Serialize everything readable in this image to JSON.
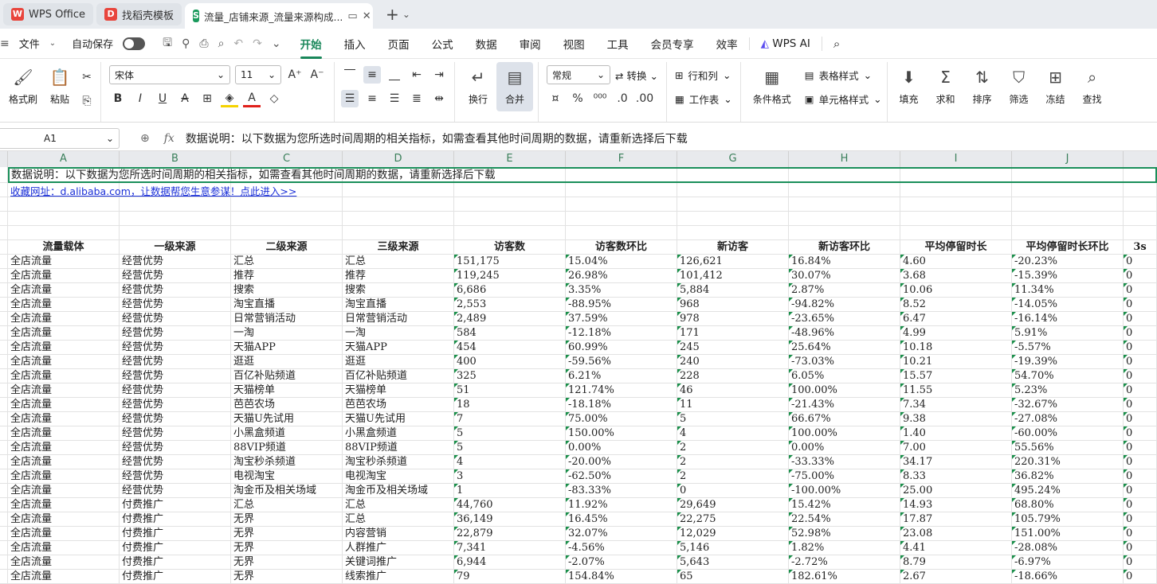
{
  "tabs": [
    {
      "label": "WPS Office",
      "icon": "wps-logo-icon"
    },
    {
      "label": "找稻壳模板",
      "icon": "docer-icon"
    },
    {
      "label": "流量_店铺来源_流量来源构成...",
      "icon": "spreadsheet-icon",
      "active": true
    }
  ],
  "menu": {
    "file": "文件",
    "autosave": "自动保存",
    "items": [
      "开始",
      "插入",
      "页面",
      "公式",
      "数据",
      "审阅",
      "视图",
      "工具",
      "会员专享",
      "效率"
    ],
    "ai": "WPS AI"
  },
  "ribbon": {
    "format_painter": "格式刷",
    "paste": "粘贴",
    "font_name": "宋体",
    "font_size": "11",
    "wrap": "换行",
    "merge": "合并",
    "number_format": "常规",
    "convert": "转换",
    "rowcol": "行和列",
    "worksheet": "工作表",
    "cond_format": "条件格式",
    "table_style": "表格样式",
    "cell_style": "单元格样式",
    "fill": "填充",
    "sum": "求和",
    "sort": "排序",
    "filter": "筛选",
    "freeze": "冻结",
    "find": "查找"
  },
  "formula_bar": {
    "cell_ref": "A1",
    "fx": "fx",
    "content": "数据说明：以下数据为您所选时间周期的相关指标，如需查看其他时间周期的数据，请重新选择后下载"
  },
  "columns": [
    "A",
    "B",
    "C",
    "D",
    "E",
    "F",
    "G",
    "H",
    "I",
    "J"
  ],
  "sheet": {
    "note": "数据说明：以下数据为您所选时间周期的相关指标，如需查看其他时间周期的数据，请重新选择后下载",
    "link": "收藏网址：d.alibaba.com，让数据帮您生意参谋！点此进入>>",
    "headers": [
      "流量载体",
      "一级来源",
      "二级来源",
      "三级来源",
      "访客数",
      "访客数环比",
      "新访客",
      "新访客环比",
      "平均停留时长",
      "平均停留时长环比",
      "3s"
    ],
    "rows": [
      [
        "全店流量",
        "经营优势",
        "汇总",
        "汇总",
        "151,175",
        "15.04%",
        "126,621",
        "16.84%",
        "4.60",
        "-20.23%",
        "0"
      ],
      [
        "全店流量",
        "经营优势",
        "推荐",
        "推荐",
        "119,245",
        "26.98%",
        "101,412",
        "30.07%",
        "3.68",
        "-15.39%",
        "0"
      ],
      [
        "全店流量",
        "经营优势",
        "搜索",
        "搜索",
        "6,686",
        "3.35%",
        "5,884",
        "2.87%",
        "10.06",
        "11.34%",
        "0"
      ],
      [
        "全店流量",
        "经营优势",
        "淘宝直播",
        "淘宝直播",
        "2,553",
        "-88.95%",
        "968",
        "-94.82%",
        "8.52",
        "-14.05%",
        "0"
      ],
      [
        "全店流量",
        "经营优势",
        "日常营销活动",
        "日常营销活动",
        "2,489",
        "37.59%",
        "978",
        "-23.65%",
        "6.47",
        "-16.14%",
        "0"
      ],
      [
        "全店流量",
        "经营优势",
        "一淘",
        "一淘",
        "584",
        "-12.18%",
        "171",
        "-48.96%",
        "4.99",
        "5.91%",
        "0"
      ],
      [
        "全店流量",
        "经营优势",
        "天猫APP",
        "天猫APP",
        "454",
        "60.99%",
        "245",
        "25.64%",
        "10.18",
        "-5.57%",
        "0"
      ],
      [
        "全店流量",
        "经营优势",
        "逛逛",
        "逛逛",
        "400",
        "-59.56%",
        "240",
        "-73.03%",
        "10.21",
        "-19.39%",
        "0"
      ],
      [
        "全店流量",
        "经营优势",
        "百亿补贴频道",
        "百亿补贴频道",
        "325",
        "6.21%",
        "228",
        "6.05%",
        "15.57",
        "54.70%",
        "0"
      ],
      [
        "全店流量",
        "经营优势",
        "天猫榜单",
        "天猫榜单",
        "51",
        "121.74%",
        "46",
        "100.00%",
        "11.55",
        "5.23%",
        "0"
      ],
      [
        "全店流量",
        "经营优势",
        "芭芭农场",
        "芭芭农场",
        "18",
        "-18.18%",
        "11",
        "-21.43%",
        "7.34",
        "-32.67%",
        "0"
      ],
      [
        "全店流量",
        "经营优势",
        "天猫U先试用",
        "天猫U先试用",
        "7",
        "75.00%",
        "5",
        "66.67%",
        "9.38",
        "-27.08%",
        "0"
      ],
      [
        "全店流量",
        "经营优势",
        "小黑盒频道",
        "小黑盒频道",
        "5",
        "150.00%",
        "4",
        "100.00%",
        "1.40",
        "-60.00%",
        "0"
      ],
      [
        "全店流量",
        "经营优势",
        "88VIP频道",
        "88VIP频道",
        "5",
        "0.00%",
        "2",
        "0.00%",
        "7.00",
        "55.56%",
        "0"
      ],
      [
        "全店流量",
        "经营优势",
        "淘宝秒杀频道",
        "淘宝秒杀频道",
        "4",
        "-20.00%",
        "2",
        "-33.33%",
        "34.17",
        "220.31%",
        "0"
      ],
      [
        "全店流量",
        "经营优势",
        "电视淘宝",
        "电视淘宝",
        "3",
        "-62.50%",
        "2",
        "-75.00%",
        "8.33",
        "36.82%",
        "0"
      ],
      [
        "全店流量",
        "经营优势",
        "淘金币及相关场域",
        "淘金币及相关场域",
        "1",
        "-83.33%",
        "0",
        "-100.00%",
        "25.00",
        "495.24%",
        "0"
      ],
      [
        "全店流量",
        "付费推广",
        "汇总",
        "汇总",
        "44,760",
        "11.92%",
        "29,649",
        "15.42%",
        "14.93",
        "68.80%",
        "0"
      ],
      [
        "全店流量",
        "付费推广",
        "无界",
        "汇总",
        "36,149",
        "16.45%",
        "22,275",
        "22.54%",
        "17.87",
        "105.79%",
        "0"
      ],
      [
        "全店流量",
        "付费推广",
        "无界",
        "内容营销",
        "22,879",
        "32.07%",
        "12,029",
        "52.98%",
        "23.08",
        "151.00%",
        "0"
      ],
      [
        "全店流量",
        "付费推广",
        "无界",
        "人群推广",
        "7,341",
        "-4.56%",
        "5,146",
        "1.82%",
        "4.41",
        "-28.08%",
        "0"
      ],
      [
        "全店流量",
        "付费推广",
        "无界",
        "关键词推广",
        "6,944",
        "-2.07%",
        "5,643",
        "-2.72%",
        "8.79",
        "-6.97%",
        "0"
      ],
      [
        "全店流量",
        "付费推广",
        "无界",
        "线索推广",
        "79",
        "154.84%",
        "65",
        "182.61%",
        "2.67",
        "-18.66%",
        "0"
      ]
    ]
  }
}
